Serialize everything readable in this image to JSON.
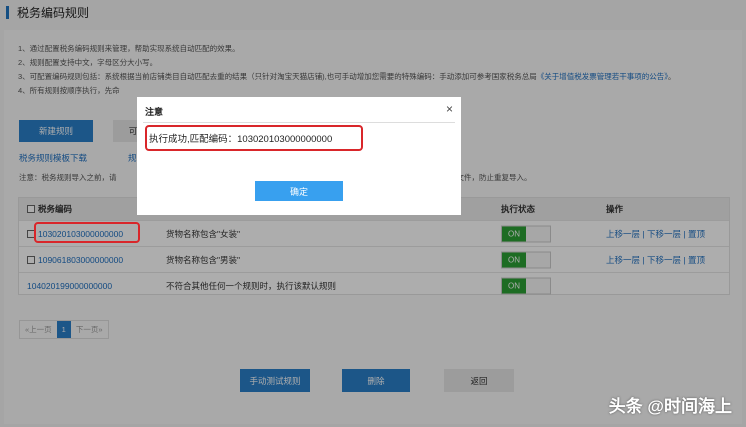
{
  "page": {
    "title": "税务编码规则"
  },
  "notes": [
    "1、通过配置税务编码规则来管理，帮助实现系统自动匹配的效果。",
    "2、规则配置支持中文，字母区分大小写。",
    "3、可配置编码规则包括：系统根据当前店铺类目自动匹配去重的结果（只针对淘宝天猫店铺),也可手动增加您需要的特殊编码：手动添加可参考国家税务总局",
    "《关于增值税发票管理若干事项的公告》",
    "。",
    "4、所有规则按顺序执行，先命"
  ],
  "actions": {
    "new_rule": "新建规则",
    "partial_button": "可",
    "template_download": "税务规则模板下载",
    "partial_link": "规"
  },
  "warning": {
    "prefix": "注意：税务规则导入之前，请",
    "suffix": "换文件，防止重复导入。"
  },
  "table": {
    "headers": {
      "code": "税务编码",
      "status": "执行状态",
      "ops": "操作"
    },
    "rows": [
      {
        "code": "103020103000000000",
        "desc": "货物名称包含\"女装\"",
        "status": "ON",
        "ops": [
          "上移一层",
          "下移一层",
          "置顶"
        ]
      },
      {
        "code": "109061803000000000",
        "desc": "货物名称包含\"男装\"",
        "status": "ON",
        "ops": [
          "上移一层",
          "下移一层",
          "置顶"
        ]
      },
      {
        "code": "104020199000000000",
        "desc": "不符合其他任何一个规则时，执行该默认规则",
        "status": "ON"
      }
    ],
    "sep": "|"
  },
  "pager": {
    "prev": "«上一页",
    "current": "1",
    "next": "下一页»"
  },
  "footer": {
    "test": "手动测试规则",
    "delete": "删除",
    "back": "返回"
  },
  "dialog": {
    "title": "注意",
    "close": "×",
    "message": "执行成功,匹配编码：103020103000000000",
    "ok": "确定"
  },
  "watermark": "头条 @时间海上",
  "colors": {
    "primary": "#2a7fc9",
    "toggle_on": "#2ba034",
    "highlight": "#d9262a"
  }
}
